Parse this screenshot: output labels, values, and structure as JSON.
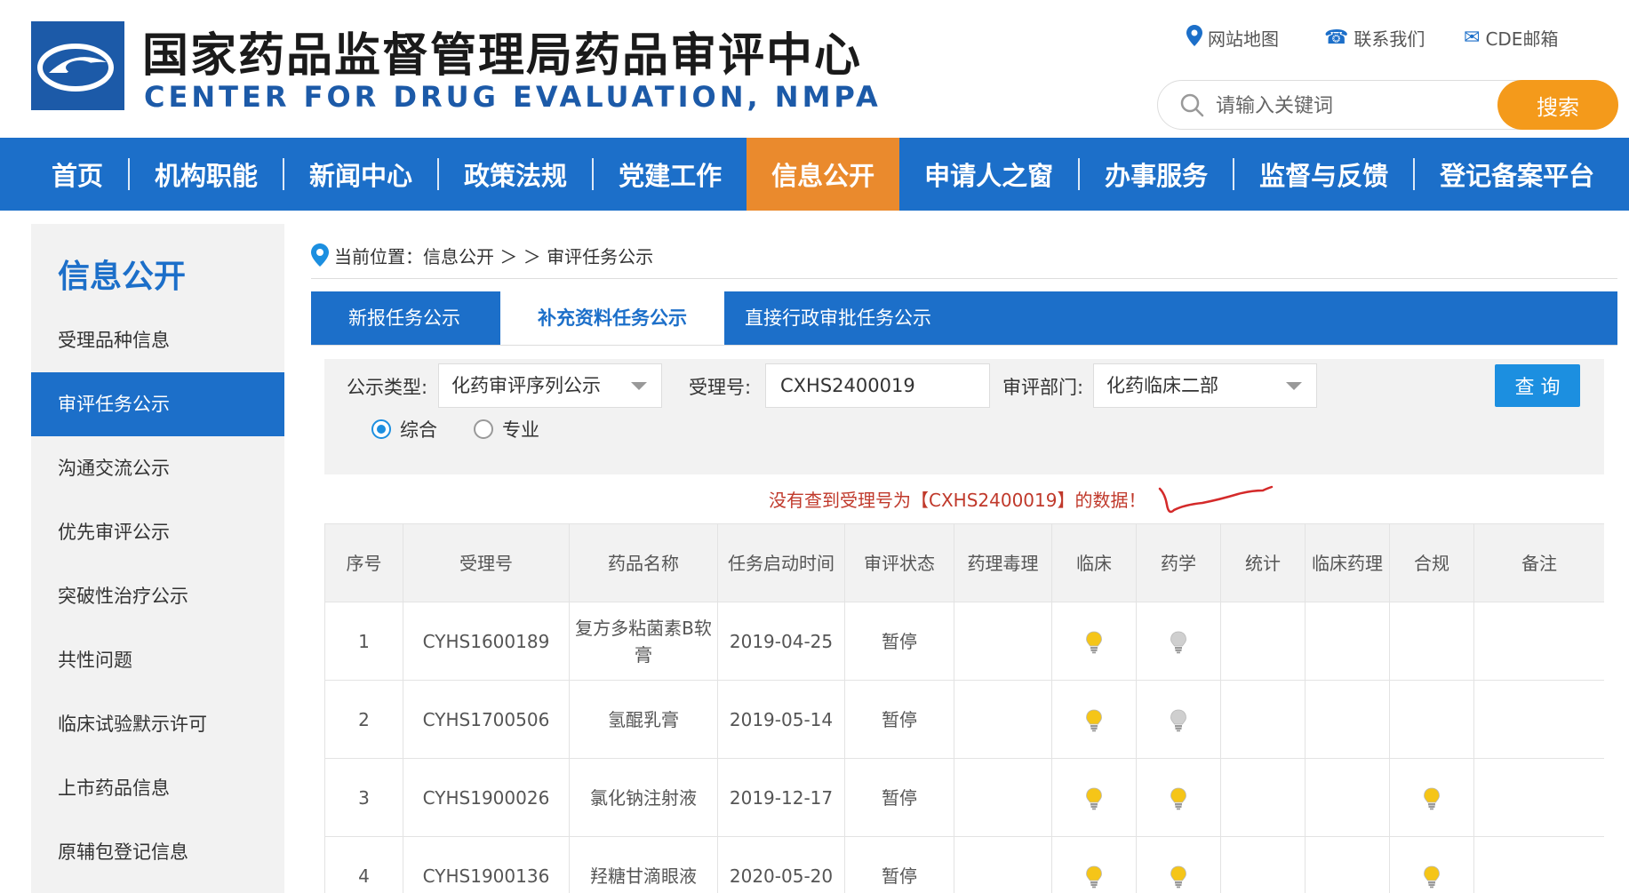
{
  "header": {
    "title_cn": "国家药品监督管理局药品审评中心",
    "title_en": "CENTER FOR DRUG EVALUATION, NMPA",
    "top_links": [
      {
        "icon": "map-pin-icon",
        "label": "网站地图"
      },
      {
        "icon": "phone-icon",
        "label": "联系我们"
      },
      {
        "icon": "mail-icon",
        "label": "CDE邮箱"
      }
    ],
    "search": {
      "placeholder": "请输入关键词",
      "button": "搜索"
    }
  },
  "nav": {
    "items": [
      "首页",
      "机构职能",
      "新闻中心",
      "政策法规",
      "党建工作",
      "信息公开",
      "申请人之窗",
      "办事服务",
      "监督与反馈",
      "登记备案平台"
    ],
    "active": "信息公开"
  },
  "sidebar": {
    "title": "信息公开",
    "items": [
      "受理品种信息",
      "审评任务公示",
      "沟通交流公示",
      "优先审评公示",
      "突破性治疗公示",
      "共性问题",
      "临床试验默示许可",
      "上市药品信息",
      "原辅包登记信息"
    ],
    "active": "审评任务公示"
  },
  "breadcrumb": {
    "prefix": "当前位置：",
    "path": "信息公开 ＞ ＞ 审评任务公示"
  },
  "tabs": {
    "items": [
      "新报任务公示",
      "补充资料任务公示",
      "直接行政审批任务公示"
    ],
    "active": "补充资料任务公示"
  },
  "filter": {
    "type_label": "公示类型:",
    "type_value": "化药审评序列公示",
    "accept_label": "受理号:",
    "accept_value": "CXHS2400019",
    "dept_label": "审评部门:",
    "dept_value": "化药临床二部",
    "query_button": "查 询",
    "radio_options": [
      "综合",
      "专业"
    ],
    "radio_selected": "综合"
  },
  "message": "没有查到受理号为【CXHS2400019】的数据！",
  "table": {
    "columns": [
      "序号",
      "受理号",
      "药品名称",
      "任务启动时间",
      "审评状态",
      "药理毒理",
      "临床",
      "药学",
      "统计",
      "临床药理",
      "合规",
      "备注"
    ],
    "rows": [
      {
        "no": "1",
        "accept_no": "CYHS1600189",
        "name": "复方多粘菌素B软膏",
        "start": "2019-04-25",
        "status": "暂停",
        "pharm_tox": "",
        "clinical": "lit",
        "pharmacy": "dim",
        "stats": "",
        "clin_pharm": "",
        "compliance": "",
        "remark": ""
      },
      {
        "no": "2",
        "accept_no": "CYHS1700506",
        "name": "氢醌乳膏",
        "start": "2019-05-14",
        "status": "暂停",
        "pharm_tox": "",
        "clinical": "lit",
        "pharmacy": "dim",
        "stats": "",
        "clin_pharm": "",
        "compliance": "",
        "remark": ""
      },
      {
        "no": "3",
        "accept_no": "CYHS1900026",
        "name": "氯化钠注射液",
        "start": "2019-12-17",
        "status": "暂停",
        "pharm_tox": "",
        "clinical": "lit",
        "pharmacy": "lit",
        "stats": "",
        "clin_pharm": "",
        "compliance": "lit",
        "remark": ""
      },
      {
        "no": "4",
        "accept_no": "CYHS1900136",
        "name": "羟糖甘滴眼液",
        "start": "2020-05-20",
        "status": "暂停",
        "pharm_tox": "",
        "clinical": "lit",
        "pharmacy": "lit",
        "stats": "",
        "clin_pharm": "",
        "compliance": "lit",
        "remark": ""
      }
    ]
  },
  "colors": {
    "primary": "#1c6fc9",
    "accent": "#ea8a2d",
    "search_button": "#f49a1b",
    "message": "#c0392b",
    "bulb_lit": "#f5c518",
    "bulb_dim": "#cfcfcf"
  }
}
